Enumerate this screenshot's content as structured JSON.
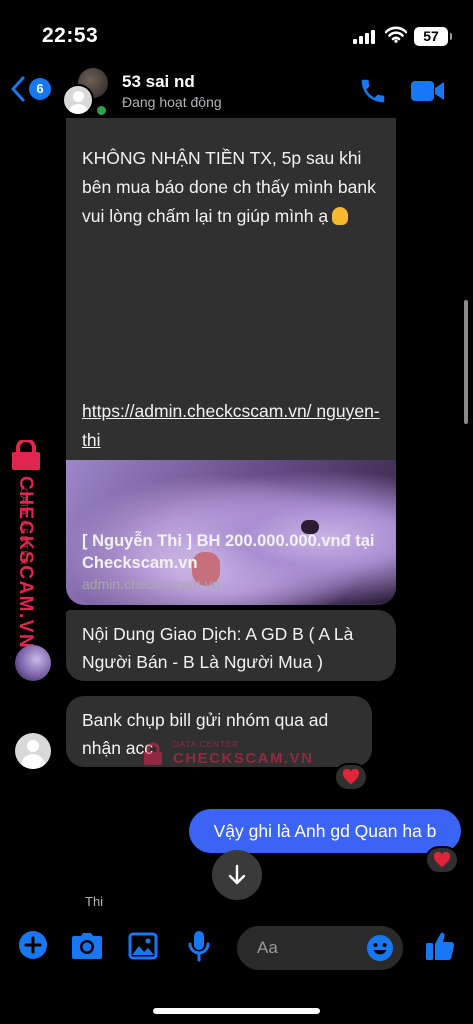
{
  "status_bar": {
    "time": "22:53",
    "battery": "57"
  },
  "header": {
    "back_badge": "6",
    "contact_name": "53 sai nd",
    "contact_status": "Đang hoạt động"
  },
  "messages": {
    "main_text": "KHÔNG NHẬN TIỀN TX, 5p sau khi bên mua báo done ch thấy mình bank vui lòng chấm lại tn giúp mình ạ",
    "link_text": "https://admin.checkcscam.vn/ nguyen-thi",
    "preview_title": "[ Nguyễn Thi ] BH 200.000.000.vnđ tại Checkscam.vn",
    "preview_domain": "admin.checkcscam.vn",
    "msg2": "Nội Dung Giao Dịch: A GD B ( A Là Người Bán - B Là Người Mua )",
    "msg3": "Bank chụp bill gửi nhóm qua ad nhận acc",
    "sent": "Vậy ghi là Anh gd Quan ha b",
    "reaction_emoji": "heart-icon"
  },
  "seen_label": "Thi",
  "watermark": {
    "main": "CHECKSCAM.VN",
    "sub": "DATA CENTER"
  },
  "composer": {
    "placeholder": "Aa"
  },
  "colors": {
    "accent": "#1877f2",
    "sent_bubble": "#3c64f4",
    "received_bubble": "#303030",
    "online": "#31a24c",
    "watermark": "#e0264f"
  }
}
